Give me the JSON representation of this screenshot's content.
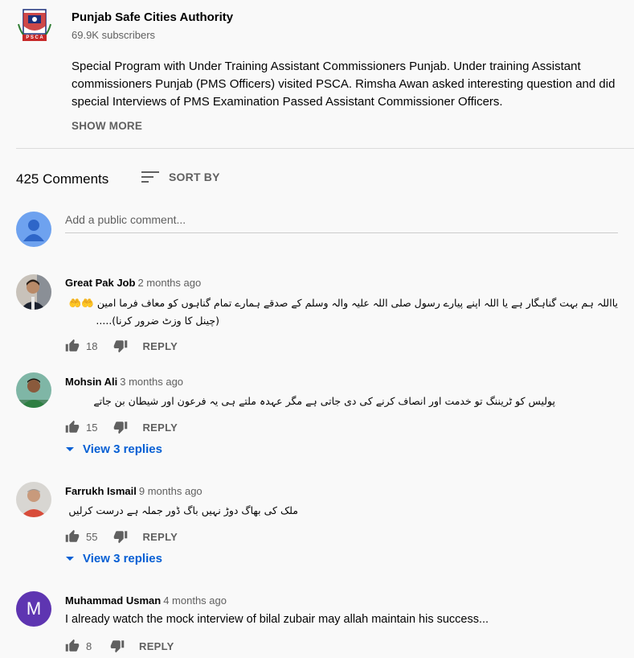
{
  "channel": {
    "name": "Punjab Safe Cities Authority",
    "subscribers": "69.9K subscribers",
    "logo_icon": "psca-shield-logo",
    "logo_text": "P S C A"
  },
  "description": {
    "text": "Special Program with Under Training Assistant Commissioners Punjab. Under training Assistant commissioners Punjab (PMS Officers) visited PSCA. Rimsha Awan asked interesting question and did special Interviews of PMS Examination Passed Assistant Commissioner Officers.",
    "show_more": "SHOW MORE"
  },
  "comments_header": {
    "count": "425 Comments",
    "sort_label": "SORT BY",
    "sort_icon": "sort-icon"
  },
  "add_comment": {
    "placeholder": "Add a public comment...",
    "avatar_icon": "default-user-avatar"
  },
  "comments": [
    {
      "author": "Great Pak Job",
      "time": "2 months ago",
      "line1": "یااللہ ہم بہت گناہگار ہے یا اللہ اپنے پیارے رسول صلی اللہ علیہ والہ وسلم کے صدقے ہمارے تمام گناہوں کو معاف فرما امین 🤲🤲",
      "line2": "(چینل کا وزٹ ضرور کرنا).....",
      "likes": "18",
      "reply_label": "REPLY"
    },
    {
      "author": "Mohsin Ali",
      "time": "3 months ago",
      "line1": "پولیس کو ٹریننگ تو خدمت اور انصاف کرنے کی دی جاتی ہے مگر عہدہ ملتے ہی یہ فرعون اور شیطان بن جاتے",
      "likes": "15",
      "reply_label": "REPLY",
      "view_replies": "View 3 replies"
    },
    {
      "author": "Farrukh Ismail",
      "time": "9 months ago",
      "line1": "ملک کی بھاگ دوڑ نہیں باگ ڈور جملہ ہے درست کرلیں",
      "likes": "55",
      "reply_label": "REPLY",
      "view_replies": "View 3 replies"
    },
    {
      "author": "Muhammad Usman",
      "time": "4 months ago",
      "line1": "I already watch the mock interview of bilal zubair may allah maintain his success...",
      "likes": "8",
      "reply_label": "REPLY",
      "avatar_letter": "M"
    }
  ],
  "colors": {
    "background": "#f9f9f9",
    "link_blue": "#065fd4",
    "muted_text": "#606060",
    "avatar_purple": "#5e35b1",
    "default_avatar_blue": "#6ea2ef"
  }
}
